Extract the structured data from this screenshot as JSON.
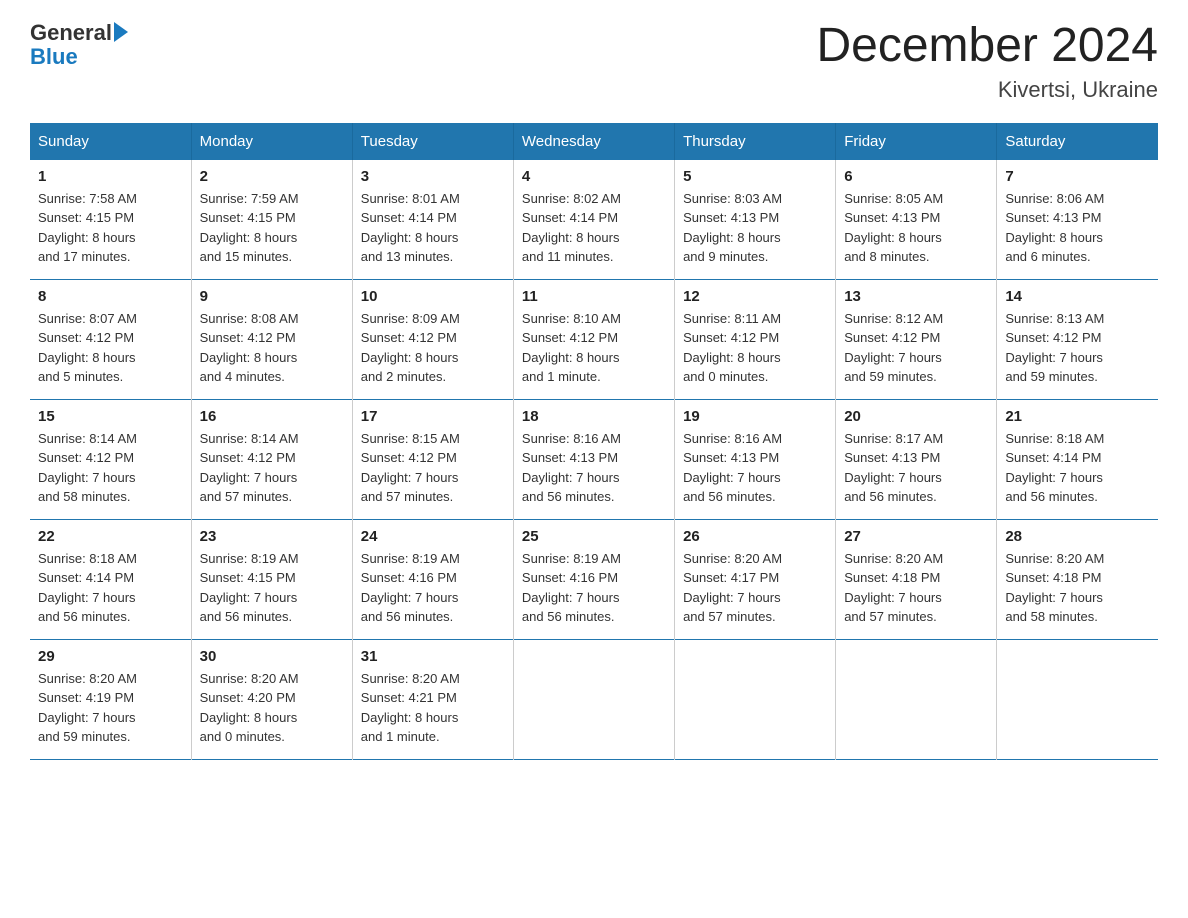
{
  "header": {
    "title": "December 2024",
    "subtitle": "Kivertsi, Ukraine"
  },
  "weekdays": [
    "Sunday",
    "Monday",
    "Tuesday",
    "Wednesday",
    "Thursday",
    "Friday",
    "Saturday"
  ],
  "weeks": [
    [
      {
        "day": "1",
        "line1": "Sunrise: 7:58 AM",
        "line2": "Sunset: 4:15 PM",
        "line3": "Daylight: 8 hours",
        "line4": "and 17 minutes."
      },
      {
        "day": "2",
        "line1": "Sunrise: 7:59 AM",
        "line2": "Sunset: 4:15 PM",
        "line3": "Daylight: 8 hours",
        "line4": "and 15 minutes."
      },
      {
        "day": "3",
        "line1": "Sunrise: 8:01 AM",
        "line2": "Sunset: 4:14 PM",
        "line3": "Daylight: 8 hours",
        "line4": "and 13 minutes."
      },
      {
        "day": "4",
        "line1": "Sunrise: 8:02 AM",
        "line2": "Sunset: 4:14 PM",
        "line3": "Daylight: 8 hours",
        "line4": "and 11 minutes."
      },
      {
        "day": "5",
        "line1": "Sunrise: 8:03 AM",
        "line2": "Sunset: 4:13 PM",
        "line3": "Daylight: 8 hours",
        "line4": "and 9 minutes."
      },
      {
        "day": "6",
        "line1": "Sunrise: 8:05 AM",
        "line2": "Sunset: 4:13 PM",
        "line3": "Daylight: 8 hours",
        "line4": "and 8 minutes."
      },
      {
        "day": "7",
        "line1": "Sunrise: 8:06 AM",
        "line2": "Sunset: 4:13 PM",
        "line3": "Daylight: 8 hours",
        "line4": "and 6 minutes."
      }
    ],
    [
      {
        "day": "8",
        "line1": "Sunrise: 8:07 AM",
        "line2": "Sunset: 4:12 PM",
        "line3": "Daylight: 8 hours",
        "line4": "and 5 minutes."
      },
      {
        "day": "9",
        "line1": "Sunrise: 8:08 AM",
        "line2": "Sunset: 4:12 PM",
        "line3": "Daylight: 8 hours",
        "line4": "and 4 minutes."
      },
      {
        "day": "10",
        "line1": "Sunrise: 8:09 AM",
        "line2": "Sunset: 4:12 PM",
        "line3": "Daylight: 8 hours",
        "line4": "and 2 minutes."
      },
      {
        "day": "11",
        "line1": "Sunrise: 8:10 AM",
        "line2": "Sunset: 4:12 PM",
        "line3": "Daylight: 8 hours",
        "line4": "and 1 minute."
      },
      {
        "day": "12",
        "line1": "Sunrise: 8:11 AM",
        "line2": "Sunset: 4:12 PM",
        "line3": "Daylight: 8 hours",
        "line4": "and 0 minutes."
      },
      {
        "day": "13",
        "line1": "Sunrise: 8:12 AM",
        "line2": "Sunset: 4:12 PM",
        "line3": "Daylight: 7 hours",
        "line4": "and 59 minutes."
      },
      {
        "day": "14",
        "line1": "Sunrise: 8:13 AM",
        "line2": "Sunset: 4:12 PM",
        "line3": "Daylight: 7 hours",
        "line4": "and 59 minutes."
      }
    ],
    [
      {
        "day": "15",
        "line1": "Sunrise: 8:14 AM",
        "line2": "Sunset: 4:12 PM",
        "line3": "Daylight: 7 hours",
        "line4": "and 58 minutes."
      },
      {
        "day": "16",
        "line1": "Sunrise: 8:14 AM",
        "line2": "Sunset: 4:12 PM",
        "line3": "Daylight: 7 hours",
        "line4": "and 57 minutes."
      },
      {
        "day": "17",
        "line1": "Sunrise: 8:15 AM",
        "line2": "Sunset: 4:12 PM",
        "line3": "Daylight: 7 hours",
        "line4": "and 57 minutes."
      },
      {
        "day": "18",
        "line1": "Sunrise: 8:16 AM",
        "line2": "Sunset: 4:13 PM",
        "line3": "Daylight: 7 hours",
        "line4": "and 56 minutes."
      },
      {
        "day": "19",
        "line1": "Sunrise: 8:16 AM",
        "line2": "Sunset: 4:13 PM",
        "line3": "Daylight: 7 hours",
        "line4": "and 56 minutes."
      },
      {
        "day": "20",
        "line1": "Sunrise: 8:17 AM",
        "line2": "Sunset: 4:13 PM",
        "line3": "Daylight: 7 hours",
        "line4": "and 56 minutes."
      },
      {
        "day": "21",
        "line1": "Sunrise: 8:18 AM",
        "line2": "Sunset: 4:14 PM",
        "line3": "Daylight: 7 hours",
        "line4": "and 56 minutes."
      }
    ],
    [
      {
        "day": "22",
        "line1": "Sunrise: 8:18 AM",
        "line2": "Sunset: 4:14 PM",
        "line3": "Daylight: 7 hours",
        "line4": "and 56 minutes."
      },
      {
        "day": "23",
        "line1": "Sunrise: 8:19 AM",
        "line2": "Sunset: 4:15 PM",
        "line3": "Daylight: 7 hours",
        "line4": "and 56 minutes."
      },
      {
        "day": "24",
        "line1": "Sunrise: 8:19 AM",
        "line2": "Sunset: 4:16 PM",
        "line3": "Daylight: 7 hours",
        "line4": "and 56 minutes."
      },
      {
        "day": "25",
        "line1": "Sunrise: 8:19 AM",
        "line2": "Sunset: 4:16 PM",
        "line3": "Daylight: 7 hours",
        "line4": "and 56 minutes."
      },
      {
        "day": "26",
        "line1": "Sunrise: 8:20 AM",
        "line2": "Sunset: 4:17 PM",
        "line3": "Daylight: 7 hours",
        "line4": "and 57 minutes."
      },
      {
        "day": "27",
        "line1": "Sunrise: 8:20 AM",
        "line2": "Sunset: 4:18 PM",
        "line3": "Daylight: 7 hours",
        "line4": "and 57 minutes."
      },
      {
        "day": "28",
        "line1": "Sunrise: 8:20 AM",
        "line2": "Sunset: 4:18 PM",
        "line3": "Daylight: 7 hours",
        "line4": "and 58 minutes."
      }
    ],
    [
      {
        "day": "29",
        "line1": "Sunrise: 8:20 AM",
        "line2": "Sunset: 4:19 PM",
        "line3": "Daylight: 7 hours",
        "line4": "and 59 minutes."
      },
      {
        "day": "30",
        "line1": "Sunrise: 8:20 AM",
        "line2": "Sunset: 4:20 PM",
        "line3": "Daylight: 8 hours",
        "line4": "and 0 minutes."
      },
      {
        "day": "31",
        "line1": "Sunrise: 8:20 AM",
        "line2": "Sunset: 4:21 PM",
        "line3": "Daylight: 8 hours",
        "line4": "and 1 minute."
      },
      {
        "day": "",
        "line1": "",
        "line2": "",
        "line3": "",
        "line4": ""
      },
      {
        "day": "",
        "line1": "",
        "line2": "",
        "line3": "",
        "line4": ""
      },
      {
        "day": "",
        "line1": "",
        "line2": "",
        "line3": "",
        "line4": ""
      },
      {
        "day": "",
        "line1": "",
        "line2": "",
        "line3": "",
        "line4": ""
      }
    ]
  ]
}
